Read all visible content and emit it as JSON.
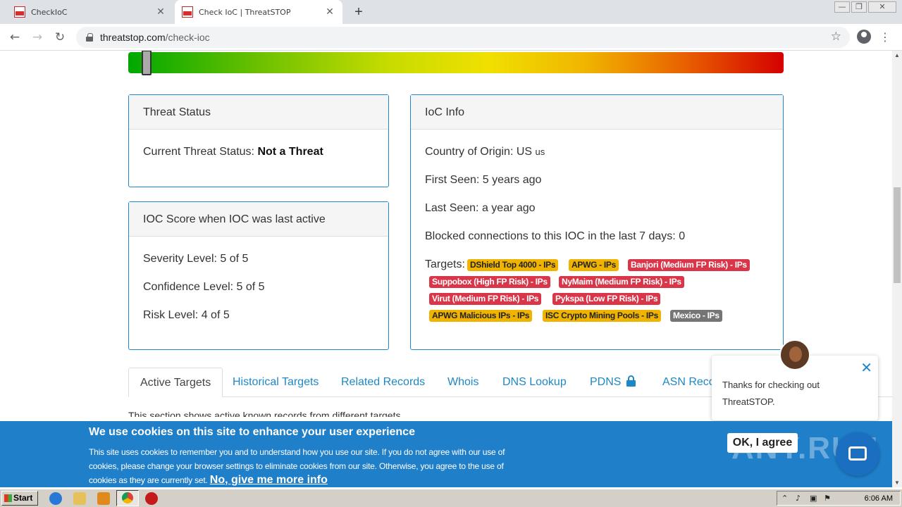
{
  "browser": {
    "tabs": [
      {
        "title": "CheckIoC",
        "active": false
      },
      {
        "title": "Check IoC | ThreatSTOP",
        "active": true
      }
    ],
    "url_host": "threatstop.com",
    "url_path": "/check-ioc",
    "window_controls": [
      "—",
      "❐",
      "✕"
    ]
  },
  "threat_status": {
    "heading": "Threat Status",
    "label": "Current Threat Status:",
    "value": "Not a Threat"
  },
  "ioc_score": {
    "heading": "IOC Score when IOC was last active",
    "severity": "Severity Level: 5 of 5",
    "confidence": "Confidence Level: 5 of 5",
    "risk": "Risk Level: 4 of 5"
  },
  "ioc_info": {
    "heading": "IoC Info",
    "country": "Country of Origin: US",
    "country_code": "us",
    "first_seen": "First Seen: 5 years ago",
    "last_seen": "Last Seen: a year ago",
    "blocked": "Blocked connections to this IOC in the last 7 days: 0",
    "targets_label": "Targets:",
    "targets": [
      {
        "label": "DShield Top 4000 - IPs",
        "color": "#f0b400"
      },
      {
        "label": "APWG - IPs",
        "color": "#f0b400"
      },
      {
        "label": "Banjori (Medium FP Risk) - IPs",
        "color": "#d9364a"
      },
      {
        "label": "Suppobox (High FP Risk) - IPs",
        "color": "#d9364a"
      },
      {
        "label": "NyMaim (Medium FP Risk) - IPs",
        "color": "#d9364a"
      },
      {
        "label": "Virut (Medium FP Risk) - IPs",
        "color": "#d9364a"
      },
      {
        "label": "Pykspa (Low FP Risk) - IPs",
        "color": "#d9364a"
      },
      {
        "label": "APWG Malicious IPs - IPs",
        "color": "#f0b400"
      },
      {
        "label": "ISC Crypto Mining Pools - IPs",
        "color": "#f0b400"
      },
      {
        "label": "Mexico - IPs",
        "color": "#757575"
      }
    ]
  },
  "threat_gauge": {
    "level_fraction": 0.02
  },
  "page_tabs": [
    "Active Targets",
    "Historical Targets",
    "Related Records",
    "Whois",
    "DNS Lookup",
    "PDNS",
    "ASN Reco"
  ],
  "section_text": "This section shows active known records from different targets",
  "chat": {
    "message": "Thanks for checking out ThreatSTOP."
  },
  "cookie": {
    "title": "We use cookies on this site to enhance your user experience",
    "text": "This site uses cookies to remember you and to understand how you use our site. If you do not agree with our use of cookies, please change your browser settings to eliminate cookies from our site. Otherwise, you agree to the use of cookies as they are currently set.",
    "link": "No, give me more info",
    "ok_button": "OK, I agree",
    "watermark": "ANY.RUN"
  },
  "taskbar": {
    "start_label": "Start",
    "clock": "6:06 AM"
  }
}
